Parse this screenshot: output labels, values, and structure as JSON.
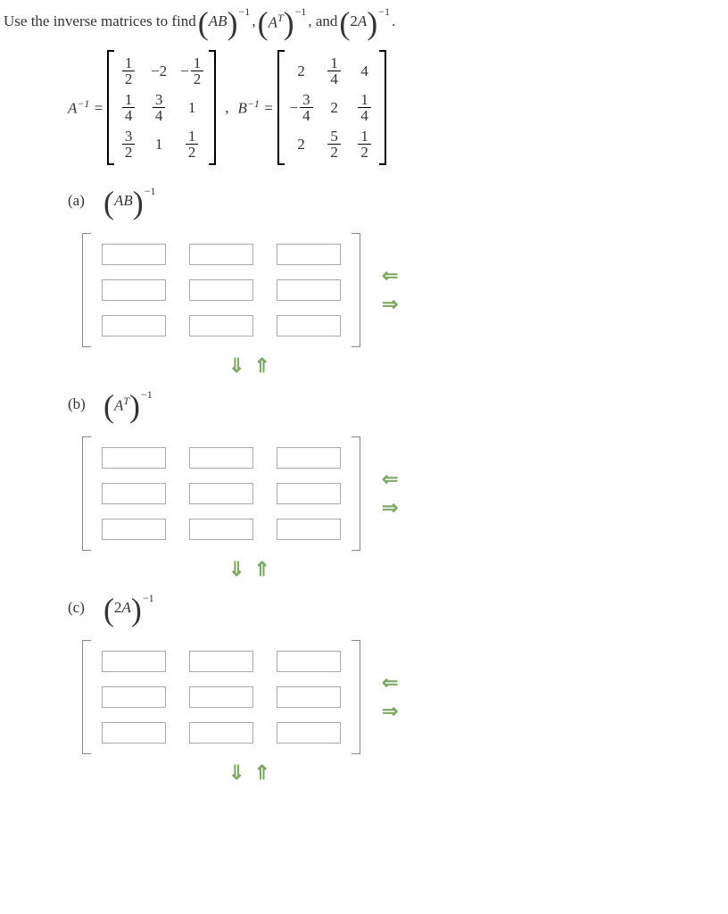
{
  "prompt": {
    "pre": "Use the inverse matrices to find ",
    "t1": "AB",
    "e1": "−1",
    "c1": ", ",
    "t2": "A",
    "tsup": "T",
    "e2": "−1",
    "c2": ", and ",
    "t3": "2A",
    "e3": "−1",
    "period": "."
  },
  "given": {
    "a_label": "A",
    "b_label": "B",
    "inv": "−1",
    "eq": " = ",
    "comma": ",",
    "A": [
      [
        {
          "frac": [
            1,
            2
          ]
        },
        {
          "v": "−2"
        },
        {
          "neg": true,
          "frac": [
            1,
            2
          ]
        }
      ],
      [
        {
          "frac": [
            1,
            4
          ]
        },
        {
          "frac": [
            3,
            4
          ]
        },
        {
          "v": "1"
        }
      ],
      [
        {
          "frac": [
            3,
            2
          ]
        },
        {
          "v": "1"
        },
        {
          "frac": [
            1,
            2
          ]
        }
      ]
    ],
    "B": [
      [
        {
          "v": "2"
        },
        {
          "frac": [
            1,
            4
          ]
        },
        {
          "v": "4"
        }
      ],
      [
        {
          "neg": true,
          "frac": [
            3,
            4
          ]
        },
        {
          "v": "2"
        },
        {
          "frac": [
            1,
            4
          ]
        }
      ],
      [
        {
          "v": "2"
        },
        {
          "frac": [
            5,
            2
          ]
        },
        {
          "frac": [
            1,
            2
          ]
        }
      ]
    ]
  },
  "parts": {
    "a": {
      "label": "(a)",
      "term": "AB",
      "exp": "−1"
    },
    "b": {
      "label": "(b)",
      "term": "A",
      "termsup": "T",
      "exp": "−1"
    },
    "c": {
      "label": "(c)",
      "term": "2A",
      "exp": "−1"
    }
  },
  "icons": {
    "left": "⇐",
    "right": "⇒",
    "down": "⇓",
    "up": "⇑"
  }
}
